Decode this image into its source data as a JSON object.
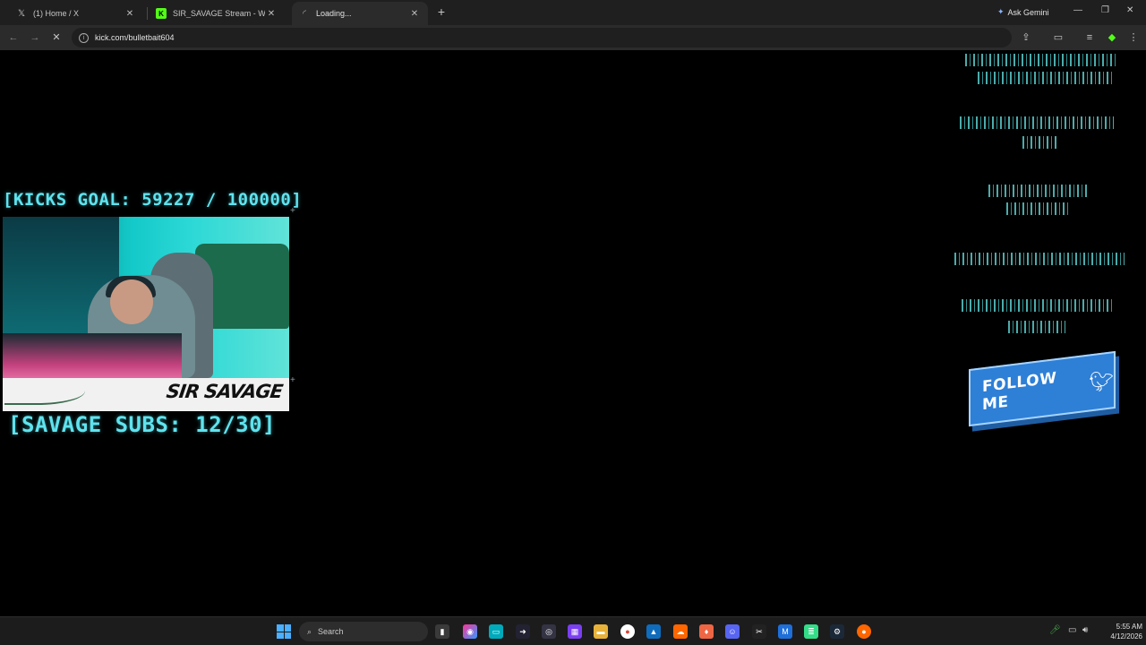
{
  "browser": {
    "tabs": [
      {
        "title": "(1) Home / X",
        "icon": "x-logo-icon",
        "active": false
      },
      {
        "title": "SIR_SAVAGE Stream - Watch Li",
        "icon": "kick-logo-icon",
        "active": false
      },
      {
        "title": "Loading...",
        "icon": "loading-spinner-icon",
        "active": true
      }
    ],
    "gemini_label": "Ask Gemini",
    "url": "kick.com/bulletbait604"
  },
  "overlay": {
    "kicks_goal": "[KICKS GOAL: 59227 / 100000]",
    "subs_goal": "[SAVAGE SUBS: 12/30]",
    "webcam_brand": "SIR SAVAGE",
    "follow_button": "FOLLOW ME",
    "colors": {
      "hud": "#5fe3ee",
      "follow": "#2e7fd6",
      "background": "#000000"
    }
  },
  "taskbar": {
    "search_placeholder": "Search",
    "time": "5:55 AM",
    "date": "4/12/2026"
  }
}
